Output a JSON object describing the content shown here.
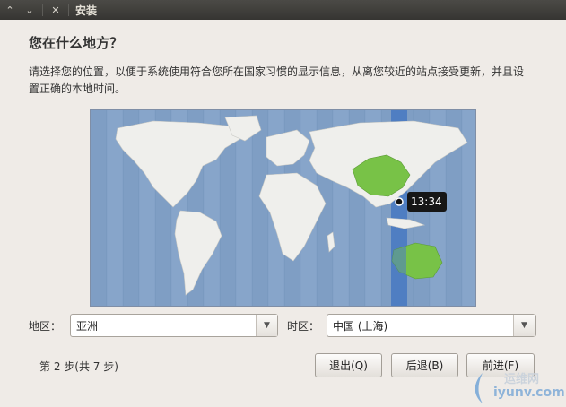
{
  "window": {
    "title": "安装"
  },
  "page": {
    "heading": "您在什么地方？",
    "description": "请选择您的位置，以便于系统使用符合您所在国家习惯的显示信息，从离您较近的站点接受更新，并且设置正确的本地时间。"
  },
  "map": {
    "time": "13:34",
    "colors": {
      "ocean": "#7f9ec4",
      "land": "#efefec",
      "selected_country": "#78c247",
      "selected_zone": "#4f7ec2"
    }
  },
  "region": {
    "label": "地区：",
    "value": "亚洲"
  },
  "timezone": {
    "label": "时区：",
    "value": "中国 (上海)"
  },
  "footer": {
    "step_text": "第 2 步(共 7 步)",
    "quit_label": "退出(Q)",
    "back_label": "后退(B)",
    "forward_label": "前进(F)"
  },
  "watermark": {
    "top_text": "运维网",
    "bottom_text": "iyunv.com"
  }
}
